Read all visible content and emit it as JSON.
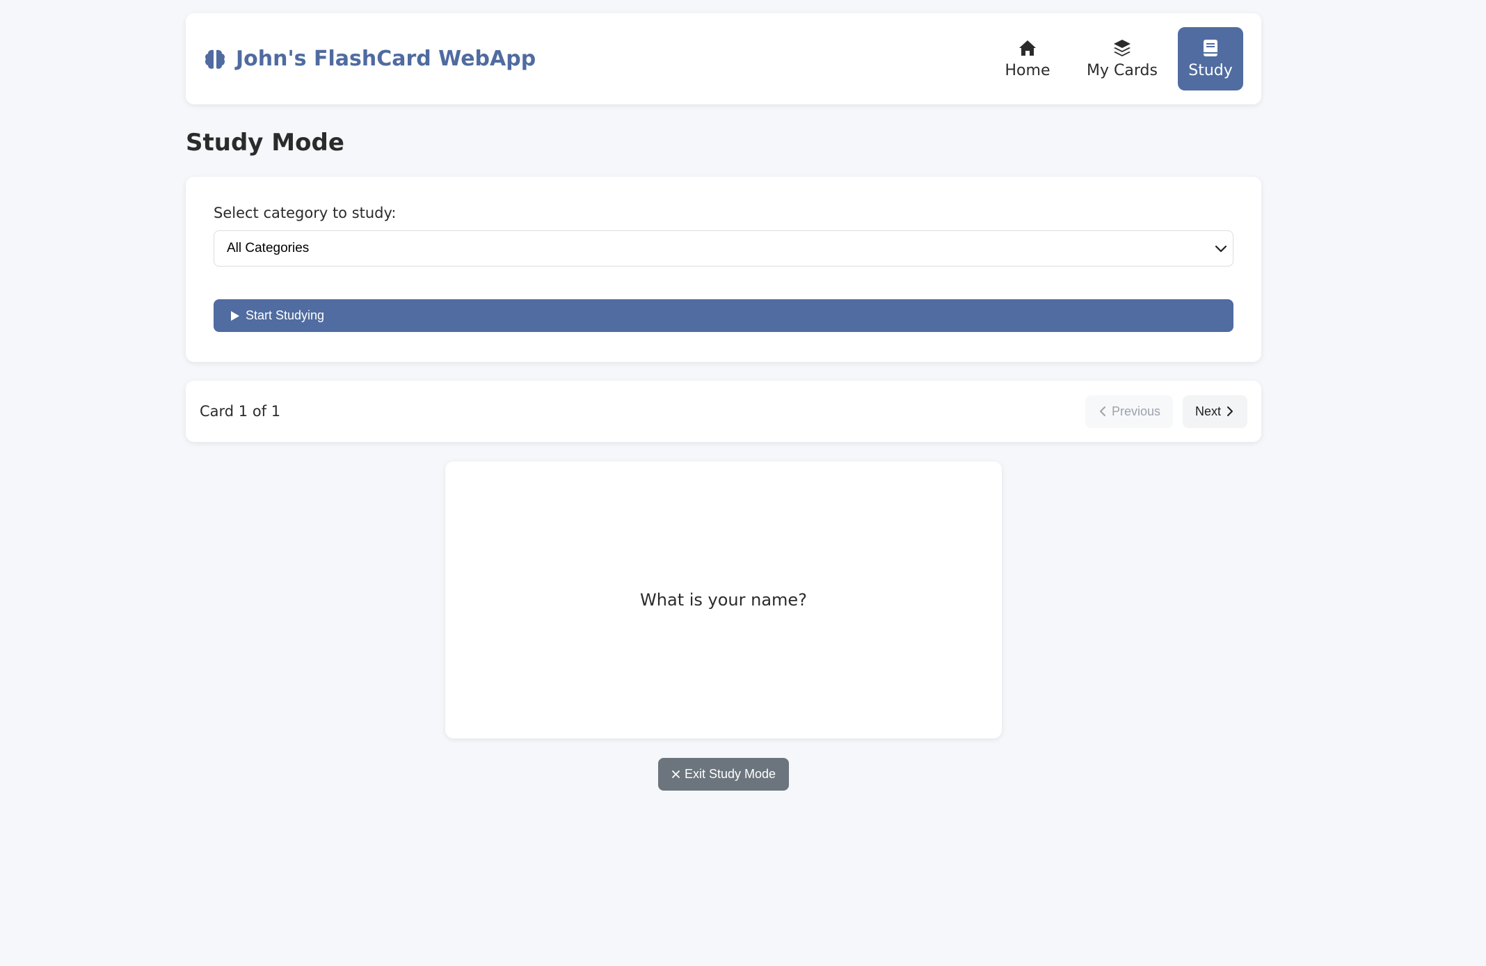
{
  "header": {
    "brand_icon": "brain-icon",
    "brand_title": "John's FlashCard WebApp",
    "nav": [
      {
        "label": "Home",
        "icon": "home-icon",
        "active": false
      },
      {
        "label": "My Cards",
        "icon": "layers-icon",
        "active": false
      },
      {
        "label": "Study",
        "icon": "book-icon",
        "active": true
      }
    ]
  },
  "page": {
    "title": "Study Mode"
  },
  "study_setup": {
    "select_label": "Select category to study:",
    "selected_category": "All Categories",
    "start_label": "Start Studying"
  },
  "navigation": {
    "counter": "Card 1 of 1",
    "previous_label": "Previous",
    "next_label": "Next"
  },
  "card": {
    "text": "What is your name?"
  },
  "exit": {
    "label": "Exit Study Mode"
  },
  "colors": {
    "accent": "#506ca0",
    "brand_text": "#4f6ba0",
    "background": "#f5f7fa",
    "exit_button": "#6c757d"
  }
}
